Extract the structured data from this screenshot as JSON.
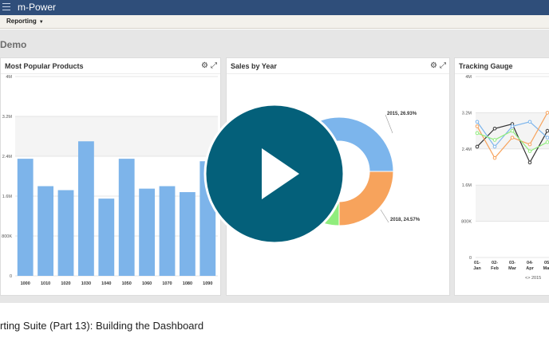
{
  "app": {
    "title": "m-Power"
  },
  "menu": {
    "reporting_label": "Reporting",
    "reporting_caret": "▼"
  },
  "page": {
    "title": "Demo"
  },
  "panels": {
    "products": {
      "title": "Most Popular Products"
    },
    "sales": {
      "title": "Sales by Year"
    },
    "gauge": {
      "title": "Tracking Gauge"
    }
  },
  "tools": {
    "settings_icon": "⚙",
    "expand_icon": "⤢"
  },
  "video": {
    "play_icon": "play-icon"
  },
  "caption": "rting Suite (Part 13): Building the Dashboard",
  "colors": {
    "bar": "#7db4ea",
    "donut_blue": "#7cb5ec",
    "donut_orange": "#f7a35c",
    "donut_green": "#90ed7d",
    "play_circle": "#04607a",
    "topbar": "#2f4e7a"
  },
  "chart_data": [
    {
      "type": "bar",
      "title": "Most Popular Products",
      "categories": [
        "1000",
        "1010",
        "1020",
        "1030",
        "1040",
        "1050",
        "1060",
        "1070",
        "1080",
        "1090"
      ],
      "values": [
        2.35,
        1.8,
        1.72,
        2.7,
        1.55,
        2.35,
        1.75,
        1.8,
        1.68,
        2.3
      ],
      "unit": "M",
      "y_ticks": [
        "0",
        "800K",
        "1.6M",
        "2.4M",
        "3.2M",
        "4M"
      ],
      "ylim": [
        0,
        4
      ]
    },
    {
      "type": "pie",
      "title": "Sales by Year",
      "slices": [
        {
          "label": "2015, 26.93%",
          "value": 26.93
        },
        {
          "label": "2018, 24.57%",
          "value": 24.57
        }
      ]
    },
    {
      "type": "line",
      "title": "Tracking Gauge",
      "categories": [
        "01-Jan",
        "02-Feb",
        "03-Mar",
        "04-Apr",
        "05-May"
      ],
      "x_tick_top": [
        "01-",
        "02-",
        "03-",
        "04-",
        "05-"
      ],
      "x_tick_bottom": [
        "Jan",
        "Feb",
        "Mar",
        "Apr",
        "May"
      ],
      "y_ticks": [
        "0",
        "800K",
        "1.6M",
        "2.4M",
        "3.2M",
        "4M"
      ],
      "ylim": [
        0,
        4
      ],
      "legend_text": "<> 2015",
      "series": [
        {
          "color": "#333333",
          "values": [
            2.45,
            2.85,
            2.95,
            2.1,
            2.8
          ]
        },
        {
          "color": "#7cb5ec",
          "values": [
            3.0,
            2.45,
            2.9,
            3.0,
            2.65
          ]
        },
        {
          "color": "#f7a35c",
          "values": [
            2.9,
            2.2,
            2.65,
            2.5,
            3.2
          ]
        },
        {
          "color": "#90ed7d",
          "values": [
            2.75,
            2.6,
            2.8,
            2.35,
            2.55
          ]
        }
      ]
    }
  ]
}
